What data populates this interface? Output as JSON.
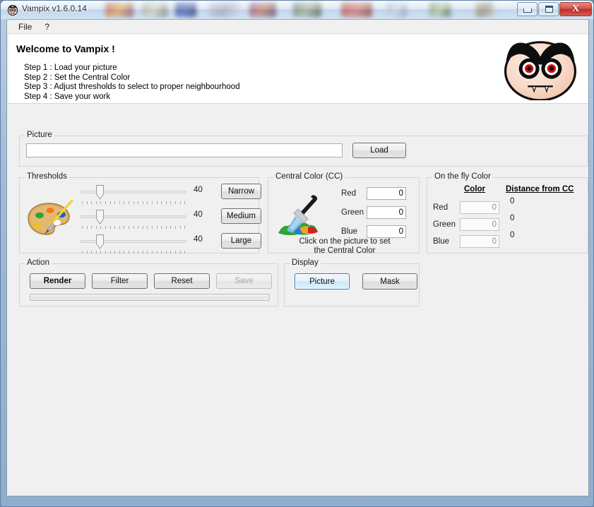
{
  "window": {
    "title": "Vampix v1.6.0.14",
    "icon": "vampire-face-icon",
    "minimize_label": "Minimize",
    "maximize_label": "Maximize",
    "close_label": "X"
  },
  "menu": {
    "items": [
      {
        "label": "File",
        "name": "menu-file"
      },
      {
        "label": "?",
        "name": "menu-help"
      }
    ]
  },
  "banner": {
    "title": "Welcome to Vampix !",
    "steps": [
      "Step 1 : Load your picture",
      "Step 2 : Set the Central Color",
      "Step 3 : Adjust thresholds to select to proper neighbourhood",
      "Step 4 : Save your work"
    ],
    "logo": "vampire-face-logo"
  },
  "picture": {
    "group_label": "Picture",
    "path_value": "",
    "path_placeholder": "",
    "load_label": "Load"
  },
  "thresholds": {
    "group_label": "Thresholds",
    "icon": "palette-icon",
    "sliders": [
      {
        "value": "40",
        "percent": 16,
        "name": "threshold-slider-1"
      },
      {
        "value": "40",
        "percent": 16,
        "name": "threshold-slider-2"
      },
      {
        "value": "40",
        "percent": 16,
        "name": "threshold-slider-3"
      }
    ],
    "preset_buttons": [
      {
        "label": "Narrow",
        "name": "narrow-button"
      },
      {
        "label": "Medium",
        "name": "medium-button"
      },
      {
        "label": "Large",
        "name": "large-button"
      }
    ]
  },
  "central_color": {
    "group_label": "Central Color (CC)",
    "icon": "eyedropper-icon",
    "channels": [
      {
        "label": "Red",
        "value": "0"
      },
      {
        "label": "Green",
        "value": "0"
      },
      {
        "label": "Blue",
        "value": "0"
      }
    ],
    "hint_line1": "Click on the picture to set",
    "hint_line2": "the Central Color"
  },
  "on_the_fly": {
    "group_label": "On the fly Color",
    "header_color": "Color",
    "header_distance": "Distance from CC",
    "rows": [
      {
        "label": "Red",
        "color_value": "0",
        "distance": "0"
      },
      {
        "label": "Green",
        "color_value": "0",
        "distance": "0"
      },
      {
        "label": "Blue",
        "color_value": "0",
        "distance": "0"
      }
    ]
  },
  "action": {
    "group_label": "Action",
    "buttons": [
      {
        "label": "Render",
        "name": "render-button",
        "style": "default",
        "enabled": true
      },
      {
        "label": "Filter",
        "name": "filter-button",
        "style": "normal",
        "enabled": true
      },
      {
        "label": "Reset",
        "name": "reset-button",
        "style": "normal",
        "enabled": true
      },
      {
        "label": "Save",
        "name": "save-button",
        "style": "normal",
        "enabled": false
      }
    ],
    "progress_percent": 0
  },
  "display": {
    "group_label": "Display",
    "buttons": [
      {
        "label": "Picture",
        "name": "picture-display-button",
        "focused": true
      },
      {
        "label": "Mask",
        "name": "mask-display-button",
        "focused": false
      }
    ]
  },
  "colors": {
    "window_border": "#5f7fa5",
    "client_bg": "#f0f0f0",
    "banner_bg": "#ffffff",
    "focus_blue": "#3c7fb1",
    "close_red": "#bb3029",
    "disabled_text": "#a5a5a5"
  }
}
